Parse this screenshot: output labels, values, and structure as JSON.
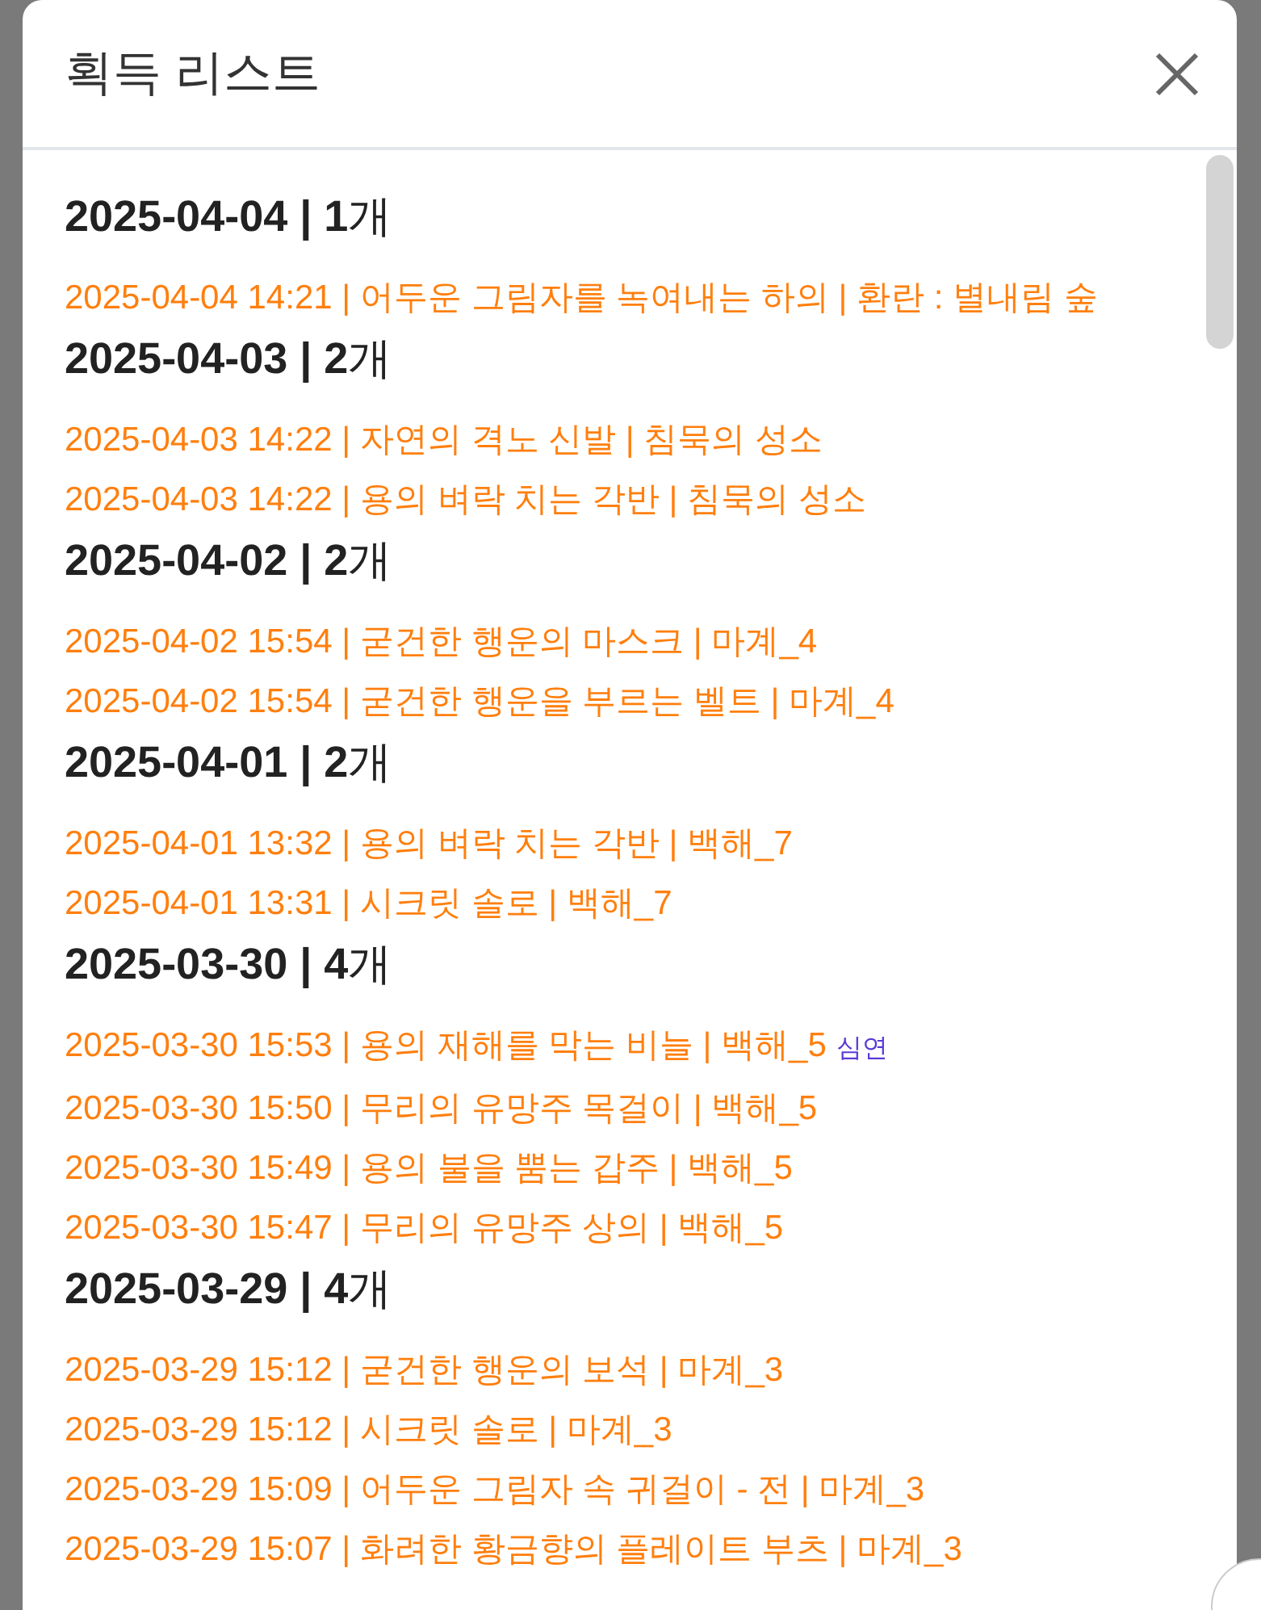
{
  "dialog": {
    "title": "획득 리스트"
  },
  "groups": [
    {
      "heading": "**2025-04-04 | 1**개",
      "items": [
        {
          "text": "2025-04-04 14:21 | 어두운 그림자를 녹여내는 하의 | 환란 : 별내림 숲"
        }
      ]
    },
    {
      "heading": "**2025-04-03 | 2**개",
      "items": [
        {
          "text": "2025-04-03 14:22 | 자연의 격노 신발 | 침묵의 성소"
        },
        {
          "text": "2025-04-03 14:22 | 용의 벼락 치는 각반 | 침묵의 성소"
        }
      ]
    },
    {
      "heading": "**2025-04-02 | 2**개",
      "items": [
        {
          "text": "2025-04-02 15:54 | 굳건한 행운의 마스크 | 마계_4"
        },
        {
          "text": "2025-04-02 15:54 | 굳건한 행운을 부르는 벨트 | 마계_4"
        }
      ]
    },
    {
      "heading": "**2025-04-01 | 2**개",
      "items": [
        {
          "text": "2025-04-01 13:32 | 용의 벼락 치는 각반 | 백해_7"
        },
        {
          "text": "2025-04-01 13:31 | 시크릿 솔로 | 백해_7"
        }
      ]
    },
    {
      "heading": "**2025-03-30 | 4**개",
      "items": [
        {
          "text": "2025-03-30 15:53 | 용의 재해를 막는 비늘 | 백해_5",
          "tag": "심연"
        },
        {
          "text": "2025-03-30 15:50 | 무리의 유망주 목걸이 | 백해_5"
        },
        {
          "text": "2025-03-30 15:49 | 용의 불을 뿜는 갑주 | 백해_5"
        },
        {
          "text": "2025-03-30 15:47 | 무리의 유망주 상의 | 백해_5"
        }
      ]
    },
    {
      "heading": "**2025-03-29 | 4**개",
      "items": [
        {
          "text": "2025-03-29 15:12 | 굳건한 행운의 보석 | 마계_3"
        },
        {
          "text": "2025-03-29 15:12 | 시크릿 솔로 | 마계_3"
        },
        {
          "text": "2025-03-29 15:09 | 어두운 그림자 속 귀걸이 - 전 | 마계_3"
        },
        {
          "text": "2025-03-29 15:07 | 화려한 황금향의 플레이트 부츠 | 마계_3"
        }
      ]
    }
  ]
}
